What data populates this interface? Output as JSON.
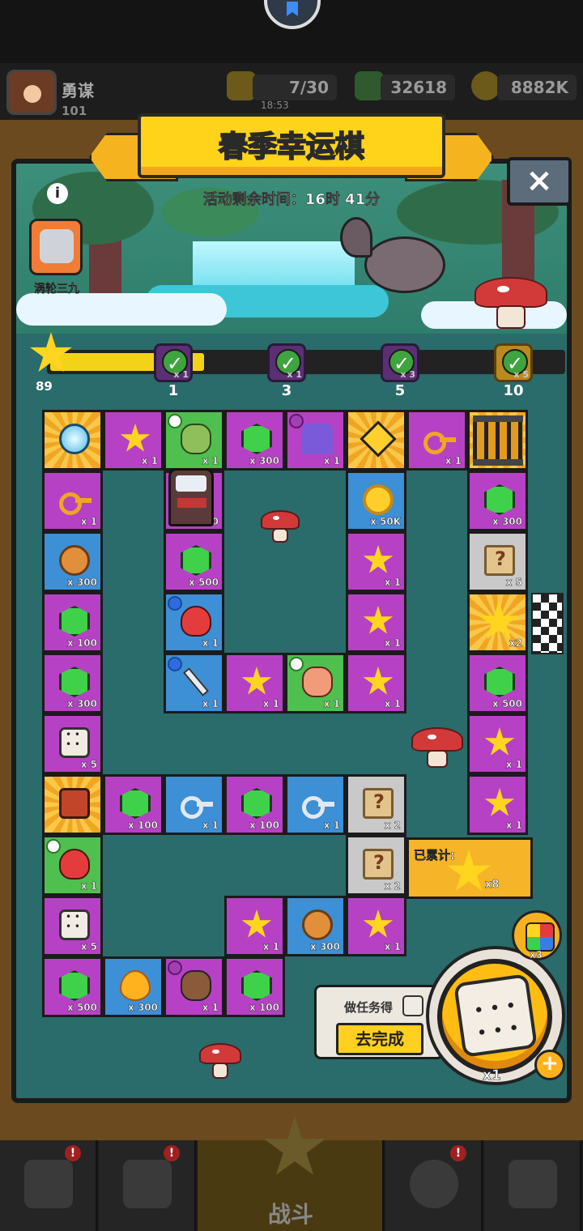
{
  "player": {
    "name": "勇谋",
    "level": "101"
  },
  "resources": {
    "energy": "7/30",
    "energy_timer": "18:53",
    "gems": "32618",
    "coins": "8882K"
  },
  "event": {
    "title": "春季幸运棋",
    "timer_label": "活动剩余时间：16时 41分",
    "boss_name": "涡轮三九",
    "close_label": "×",
    "info_label": "i"
  },
  "progress": {
    "stars": "89",
    "fill_fraction": 0.3,
    "checkpoints": [
      {
        "label": "1",
        "mult": "x 1"
      },
      {
        "label": "3",
        "mult": "x 1"
      },
      {
        "label": "5",
        "mult": "x 3"
      },
      {
        "label": "10",
        "mult": "x 5"
      }
    ]
  },
  "board": {
    "tiles": [
      {
        "color": "gold",
        "icon": "crystal-ball-icon",
        "qty": ""
      },
      {
        "color": "purple",
        "icon": "star-icon",
        "qty": "x 1"
      },
      {
        "color": "green",
        "icon": "frog-icon",
        "qty": "x 1",
        "badge": "g"
      },
      {
        "color": "purple",
        "icon": "gem-icon",
        "qty": "x 300"
      },
      {
        "color": "purple",
        "icon": "ghost-icon",
        "qty": "x 1",
        "badge": "p"
      },
      {
        "color": "gold",
        "icon": "arrow-sign-icon",
        "qty": ""
      },
      {
        "color": "purple",
        "icon": "gold-key-icon",
        "qty": "x 1"
      },
      {
        "color": "gold",
        "icon": "cage-icon",
        "qty": ""
      },
      {
        "color": "purple",
        "icon": "gold-key-icon",
        "qty": "x 1"
      },
      {
        "color": "purple",
        "icon": "hero-icon",
        "qty": "x 100"
      },
      {
        "color": "blue",
        "icon": "coin-icon",
        "qty": "x 50K"
      },
      {
        "color": "purple",
        "icon": "gem-icon",
        "qty": "x 300"
      },
      {
        "color": "blue",
        "icon": "lion-medal-icon",
        "qty": "x 300"
      },
      {
        "color": "purple",
        "icon": "gem-icon",
        "qty": "x 500"
      },
      {
        "color": "purple",
        "icon": "star-icon",
        "qty": "x 1"
      },
      {
        "color": "gray",
        "icon": "map-icon",
        "qty": "x 5"
      },
      {
        "color": "purple",
        "icon": "gem-icon",
        "qty": "x 100"
      },
      {
        "color": "blue",
        "icon": "crab-icon",
        "qty": "x 1",
        "badge": "b"
      },
      {
        "color": "purple",
        "icon": "star-icon",
        "qty": "x 1"
      },
      {
        "color": "gold",
        "icon": "star-icon",
        "qty": "x2"
      },
      {
        "color": "purple",
        "icon": "gem-icon",
        "qty": "x 300"
      },
      {
        "color": "blue",
        "icon": "sword-icon",
        "qty": "x 1",
        "badge": "b"
      },
      {
        "color": "purple",
        "icon": "star-icon",
        "qty": "x 1"
      },
      {
        "color": "green",
        "icon": "claw-icon",
        "qty": "x 1",
        "badge": "g"
      },
      {
        "color": "purple",
        "icon": "star-icon",
        "qty": "x 1"
      },
      {
        "color": "purple",
        "icon": "gem-icon",
        "qty": "x 500"
      },
      {
        "color": "purple",
        "icon": "dice-icon",
        "qty": "x 5"
      },
      {
        "color": "purple",
        "icon": "star-icon",
        "qty": "x 1"
      },
      {
        "color": "gold",
        "icon": "train-icon",
        "qty": ""
      },
      {
        "color": "purple",
        "icon": "gem-icon",
        "qty": "x 100"
      },
      {
        "color": "blue",
        "icon": "silver-key-icon",
        "qty": "x 1"
      },
      {
        "color": "purple",
        "icon": "gem-icon",
        "qty": "x 100"
      },
      {
        "color": "blue",
        "icon": "silver-key-icon",
        "qty": "x 1"
      },
      {
        "color": "gray",
        "icon": "map-icon",
        "qty": "x 2"
      },
      {
        "color": "purple",
        "icon": "star-icon",
        "qty": "x 1"
      },
      {
        "color": "green",
        "icon": "crab-icon",
        "qty": "x 1",
        "badge": "g"
      },
      {
        "color": "gray",
        "icon": "map-icon",
        "qty": "x 2"
      },
      {
        "color": "purple",
        "icon": "dice-icon",
        "qty": "x 5"
      },
      {
        "color": "purple",
        "icon": "star-icon",
        "qty": "x 1"
      },
      {
        "color": "blue",
        "icon": "lion-medal-icon",
        "qty": "x 300"
      },
      {
        "color": "purple",
        "icon": "star-icon",
        "qty": "x 1"
      },
      {
        "color": "purple",
        "icon": "gem-icon",
        "qty": "x 500"
      },
      {
        "color": "blue",
        "icon": "flame-icon",
        "qty": "x 300"
      },
      {
        "color": "purple",
        "icon": "dog-icon",
        "qty": "x 1",
        "badge": "p"
      },
      {
        "color": "purple",
        "icon": "gem-icon",
        "qty": "x 100"
      }
    ],
    "accumulated": {
      "label": "已累计:",
      "qty": "x8"
    }
  },
  "actions": {
    "task_label": "做任务得",
    "go_label": "去完成",
    "dice_qty": "x1",
    "color_dice_qty": "x3",
    "plus_label": "+"
  },
  "nav": {
    "fight_label": "战斗",
    "badge": "!"
  }
}
